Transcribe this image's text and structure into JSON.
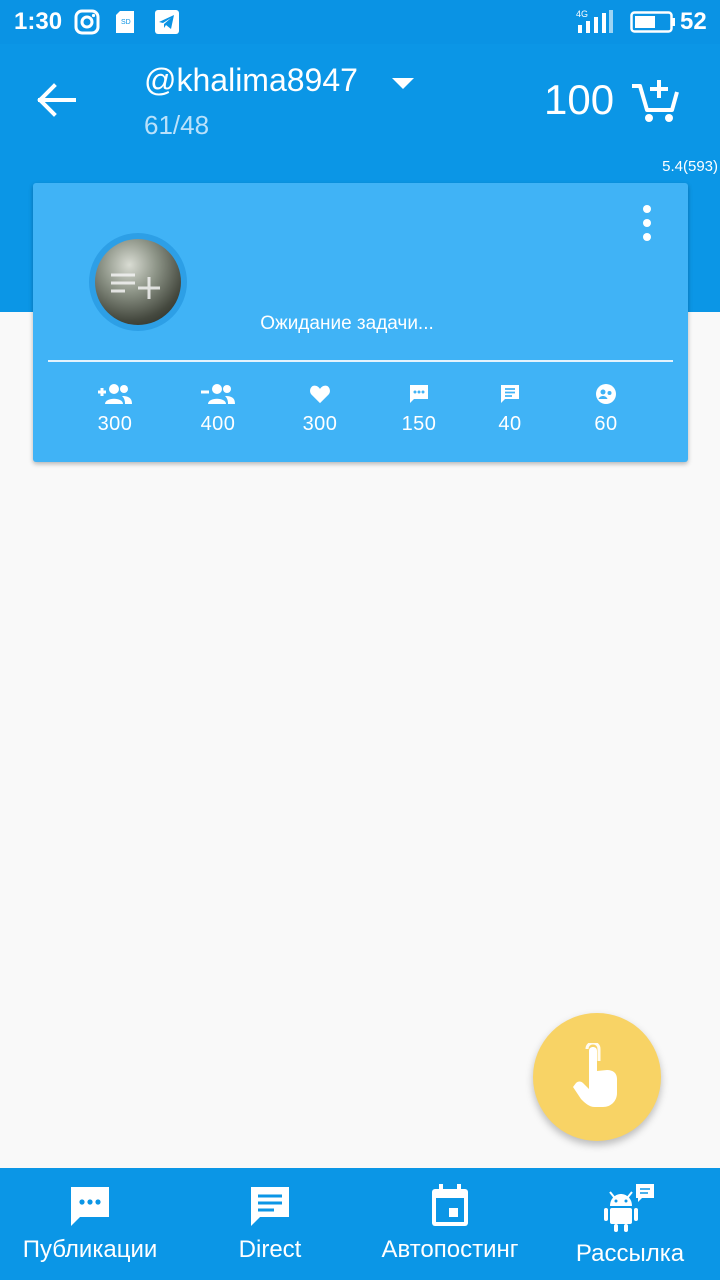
{
  "status_bar": {
    "time": "1:30",
    "network": "4G",
    "battery": "52",
    "notification_icons": [
      "instagram-icon",
      "sd-card-icon",
      "telegram-icon"
    ]
  },
  "header": {
    "account": "@khalima8947",
    "counter": "61/48",
    "balance": "100",
    "icons": {
      "back": "arrow-left-icon",
      "dropdown": "caret-down-icon",
      "cart": "cart-add-icon"
    }
  },
  "version": "5.4(593)",
  "task_card": {
    "status": "Ожидание задачи...",
    "stats": [
      {
        "icon": "follow-icon",
        "value": "300"
      },
      {
        "icon": "unfollow-icon",
        "value": "400"
      },
      {
        "icon": "like-icon",
        "value": "300"
      },
      {
        "icon": "comment-icon",
        "value": "150"
      },
      {
        "icon": "message-icon",
        "value": "40"
      },
      {
        "icon": "story-view-icon",
        "value": "60"
      }
    ]
  },
  "fab": {
    "icon": "tap-hand-icon"
  },
  "bottom_nav": [
    {
      "label": "Публикации",
      "icon": "chat-bubble-dots-icon"
    },
    {
      "label": "Direct",
      "icon": "message-lines-icon"
    },
    {
      "label": "Автопостинг",
      "icon": "calendar-icon"
    },
    {
      "label": "Рассылка",
      "icon": "android-message-icon"
    }
  ],
  "colors": {
    "primary": "#0b96e6",
    "card": "#40b3f6",
    "fab": "#f8d365",
    "background": "#f9f9f9"
  }
}
